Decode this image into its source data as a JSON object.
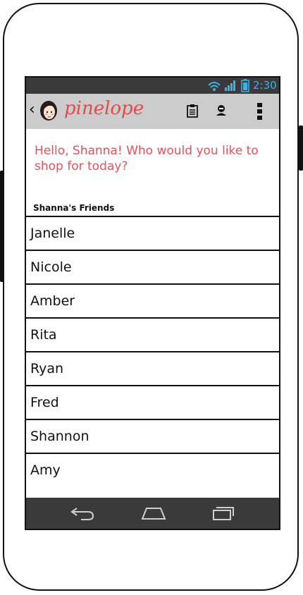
{
  "status_bar": {
    "time": "2:30",
    "icons": [
      "wifi-icon",
      "signal-icon",
      "battery-icon"
    ],
    "accent": "#36b4e5"
  },
  "action_bar": {
    "app_name": "pinelope",
    "icons": [
      "back-chevron-icon",
      "logo-avatar-icon",
      "clipboard-icon",
      "user-icon",
      "overflow-menu-icon"
    ],
    "brand_color": "#e04b4b"
  },
  "greeting": "Hello, Shanna! Who would you like to shop for today?",
  "friends_section": {
    "header": "Shanna's Friends",
    "friends": [
      "Janelle",
      "Nicole",
      "Amber",
      "Rita",
      "Ryan",
      "Fred",
      "Shannon",
      "Amy"
    ]
  },
  "nav_bar": {
    "icons": [
      "nav-back-icon",
      "nav-home-icon",
      "nav-recents-icon"
    ]
  }
}
